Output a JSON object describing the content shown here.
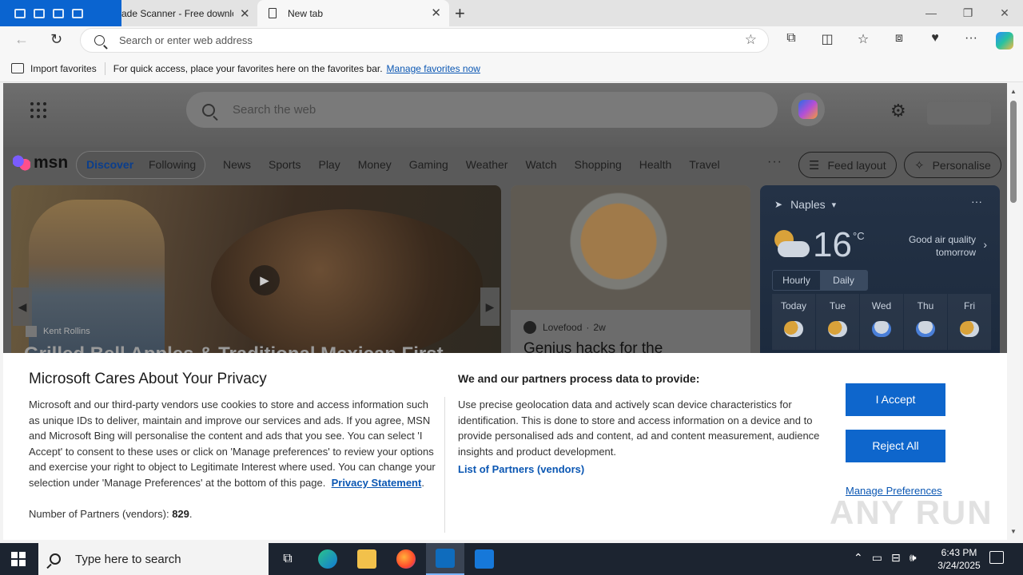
{
  "browser": {
    "tabs": [
      {
        "label": "ade Scanner - Free downloa"
      },
      {
        "label": "New tab"
      }
    ],
    "address_placeholder": "Search or enter web address",
    "favorites_bar": {
      "import_label": "Import favorites",
      "hint": "For quick access, place your favorites here on the favorites bar.",
      "manage_link": "Manage favorites now"
    }
  },
  "msn": {
    "search_placeholder": "Search the web",
    "logo": "msn",
    "feed_tabs": {
      "discover": "Discover",
      "following": "Following"
    },
    "nav": [
      "News",
      "Sports",
      "Play",
      "Money",
      "Gaming",
      "Weather",
      "Watch",
      "Shopping",
      "Health",
      "Travel"
    ],
    "more": "···",
    "feed_layout": "Feed layout",
    "personalise": "Personalise",
    "hero": {
      "source": "Kent Rollins",
      "headline": "Grilled Bell Apples & Traditional Mexican First"
    },
    "card2": {
      "source": "Lovefood",
      "age": "2w",
      "headline": "Genius hacks for the"
    },
    "weather": {
      "location": "Naples",
      "temp": "16",
      "unit": "°C",
      "air_quality": "Good air quality tomorrow",
      "tabs": [
        "Hourly",
        "Daily"
      ],
      "days": [
        {
          "label": "Today",
          "icon": "partly-sunny-icon"
        },
        {
          "label": "Tue",
          "icon": "partly-sunny-icon"
        },
        {
          "label": "Wed",
          "icon": "rain-icon"
        },
        {
          "label": "Thu",
          "icon": "rain-icon"
        },
        {
          "label": "Fri",
          "icon": "partly-sunny-icon"
        }
      ]
    }
  },
  "privacy": {
    "title": "Microsoft Cares About Your Privacy",
    "body": "Microsoft and our third-party vendors use cookies to store and access information such as unique IDs to deliver, maintain and improve our services and ads. If you agree, MSN and Microsoft Bing will personalise the content and ads that you see. You can select 'I Accept' to consent to these uses or click on 'Manage preferences' to review your options and exercise your right to object to Legitimate Interest where used.  You can change your selection under 'Manage Preferences' at the bottom of this page.",
    "privacy_link": "Privacy Statement",
    "partners_count_label": "Number of Partners (vendors):",
    "partners_count": "829",
    "right_title": "We and our partners process data to provide:",
    "right_body": "Use precise geolocation data and actively scan device characteristics for identification. This is done to store and access information on a device and to provide personalised ads and content, ad and content measurement, audience insights and product development.",
    "partners_link": "List of Partners (vendors)",
    "accept": "I Accept",
    "reject": "Reject All",
    "manage": "Manage Preferences"
  },
  "watermark": "ANY RUN",
  "taskbar": {
    "search_placeholder": "Type here to search",
    "time": "6:43 PM",
    "date": "3/24/2025"
  }
}
